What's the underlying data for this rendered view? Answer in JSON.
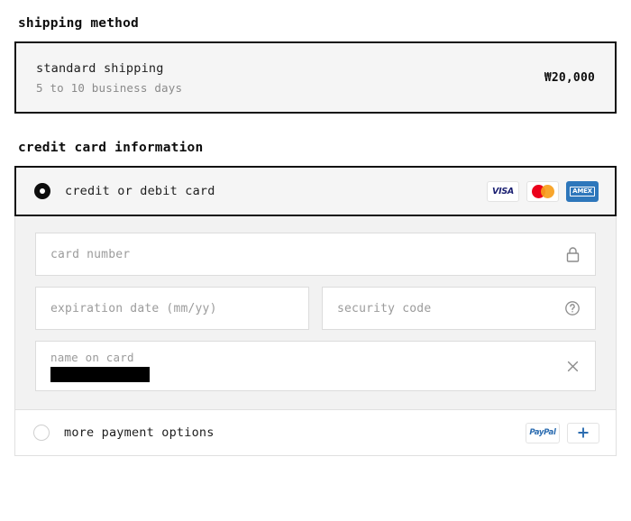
{
  "shipping": {
    "heading": "shipping method",
    "option": {
      "title": "standard shipping",
      "subtitle": "5 to 10 business days",
      "price": "₩20,000"
    }
  },
  "payment": {
    "heading": "credit card information",
    "card_option": {
      "label": "credit or debit card",
      "selected": true,
      "brands": [
        {
          "name": "visa-badge",
          "text": "VISA"
        },
        {
          "name": "mastercard-badge",
          "text": ""
        },
        {
          "name": "amex-badge",
          "text": "AMEX"
        }
      ]
    },
    "fields": {
      "card_number": {
        "placeholder": "card number",
        "value": "",
        "icon": "lock-icon"
      },
      "expiration": {
        "placeholder": "expiration date (mm/yy)",
        "value": ""
      },
      "security_code": {
        "placeholder": "security code",
        "value": "",
        "icon": "help-circle-icon"
      },
      "name_on_card": {
        "label": "name on card",
        "value": "",
        "redacted": true,
        "icon": "close-icon"
      }
    },
    "more_options": {
      "label": "more payment options",
      "selected": false,
      "badges": [
        {
          "name": "paypal-badge",
          "text": "PayPal"
        },
        {
          "name": "add-payment-method-button",
          "text": "+"
        }
      ]
    }
  },
  "colors": {
    "border_active": "#111111",
    "panel_bg": "#f5f5f5",
    "form_bg": "#f2f2f2",
    "placeholder": "#9b9b9b",
    "visa_blue": "#1a1f71",
    "amex_blue": "#2e77bb",
    "paypal_blue": "#2b6cb0",
    "mc_red": "#eb001b",
    "mc_orange": "#f79e1b"
  }
}
